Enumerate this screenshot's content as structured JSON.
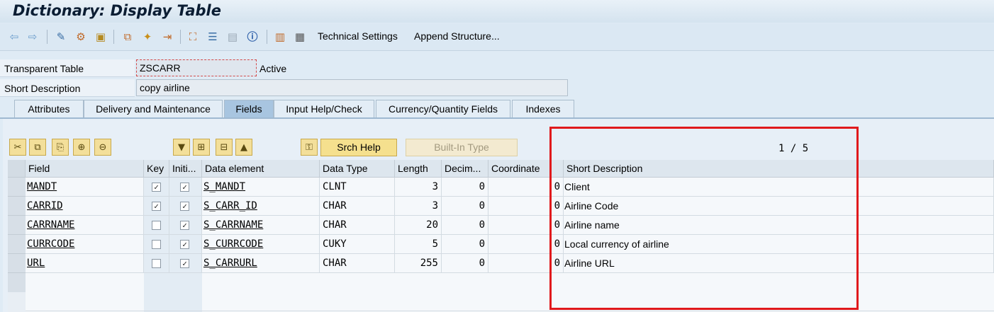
{
  "window": {
    "title": "Dictionary: Display Table"
  },
  "toolbar": {
    "icons": [
      "back-icon",
      "forward-icon",
      "other-object-icon",
      "display-change-icon",
      "activate-icon",
      "where-used-icon",
      "object-list-icon",
      "navigation-icon",
      "hierarchy-icon",
      "documentation-icon",
      "layout-icon",
      "info-icon",
      "contents-icon",
      "table-contents-icon"
    ],
    "technical_settings": "Technical Settings",
    "append_structure": "Append Structure..."
  },
  "header": {
    "table_type_label": "Transparent Table",
    "table_name": "ZSCARR",
    "status": "Active",
    "short_desc_label": "Short Description",
    "short_desc_value": "copy airline"
  },
  "tabs": [
    {
      "label": "Attributes"
    },
    {
      "label": "Delivery and Maintenance"
    },
    {
      "label": "Fields",
      "active": true
    },
    {
      "label": "Input Help/Check"
    },
    {
      "label": "Currency/Quantity Fields"
    },
    {
      "label": "Indexes"
    }
  ],
  "fields_toolbar": {
    "srch_help": "Srch Help",
    "builtin_type": "Built-In Type",
    "page": "1 / 5"
  },
  "grid": {
    "columns": [
      "Field",
      "Key",
      "Initi...",
      "Data element",
      "Data Type",
      "Length",
      "Decim...",
      "Coordinate",
      "Short Description"
    ],
    "rows": [
      {
        "field": "MANDT",
        "key": true,
        "init": true,
        "element": "S_MANDT",
        "type": "CLNT",
        "length": "3",
        "decimals": "0",
        "coord": "0",
        "desc": "Client"
      },
      {
        "field": "CARRID",
        "key": true,
        "init": true,
        "element": "S_CARR_ID",
        "type": "CHAR",
        "length": "3",
        "decimals": "0",
        "coord": "0",
        "desc": "Airline Code"
      },
      {
        "field": "CARRNAME",
        "key": false,
        "init": true,
        "element": "S_CARRNAME",
        "type": "CHAR",
        "length": "20",
        "decimals": "0",
        "coord": "0",
        "desc": "Airline name"
      },
      {
        "field": "CURRCODE",
        "key": false,
        "init": true,
        "element": "S_CURRCODE",
        "type": "CUKY",
        "length": "5",
        "decimals": "0",
        "coord": "0",
        "desc": "Local currency of airline"
      },
      {
        "field": "URL",
        "key": false,
        "init": true,
        "element": "S_CARRURL",
        "type": "CHAR",
        "length": "255",
        "decimals": "0",
        "coord": "0",
        "desc": "Airline URL"
      }
    ]
  },
  "colors": {
    "highlight_box": "#e0191c",
    "active_tab": "#a8c5e0",
    "button_yellow": "#f5e08e"
  }
}
